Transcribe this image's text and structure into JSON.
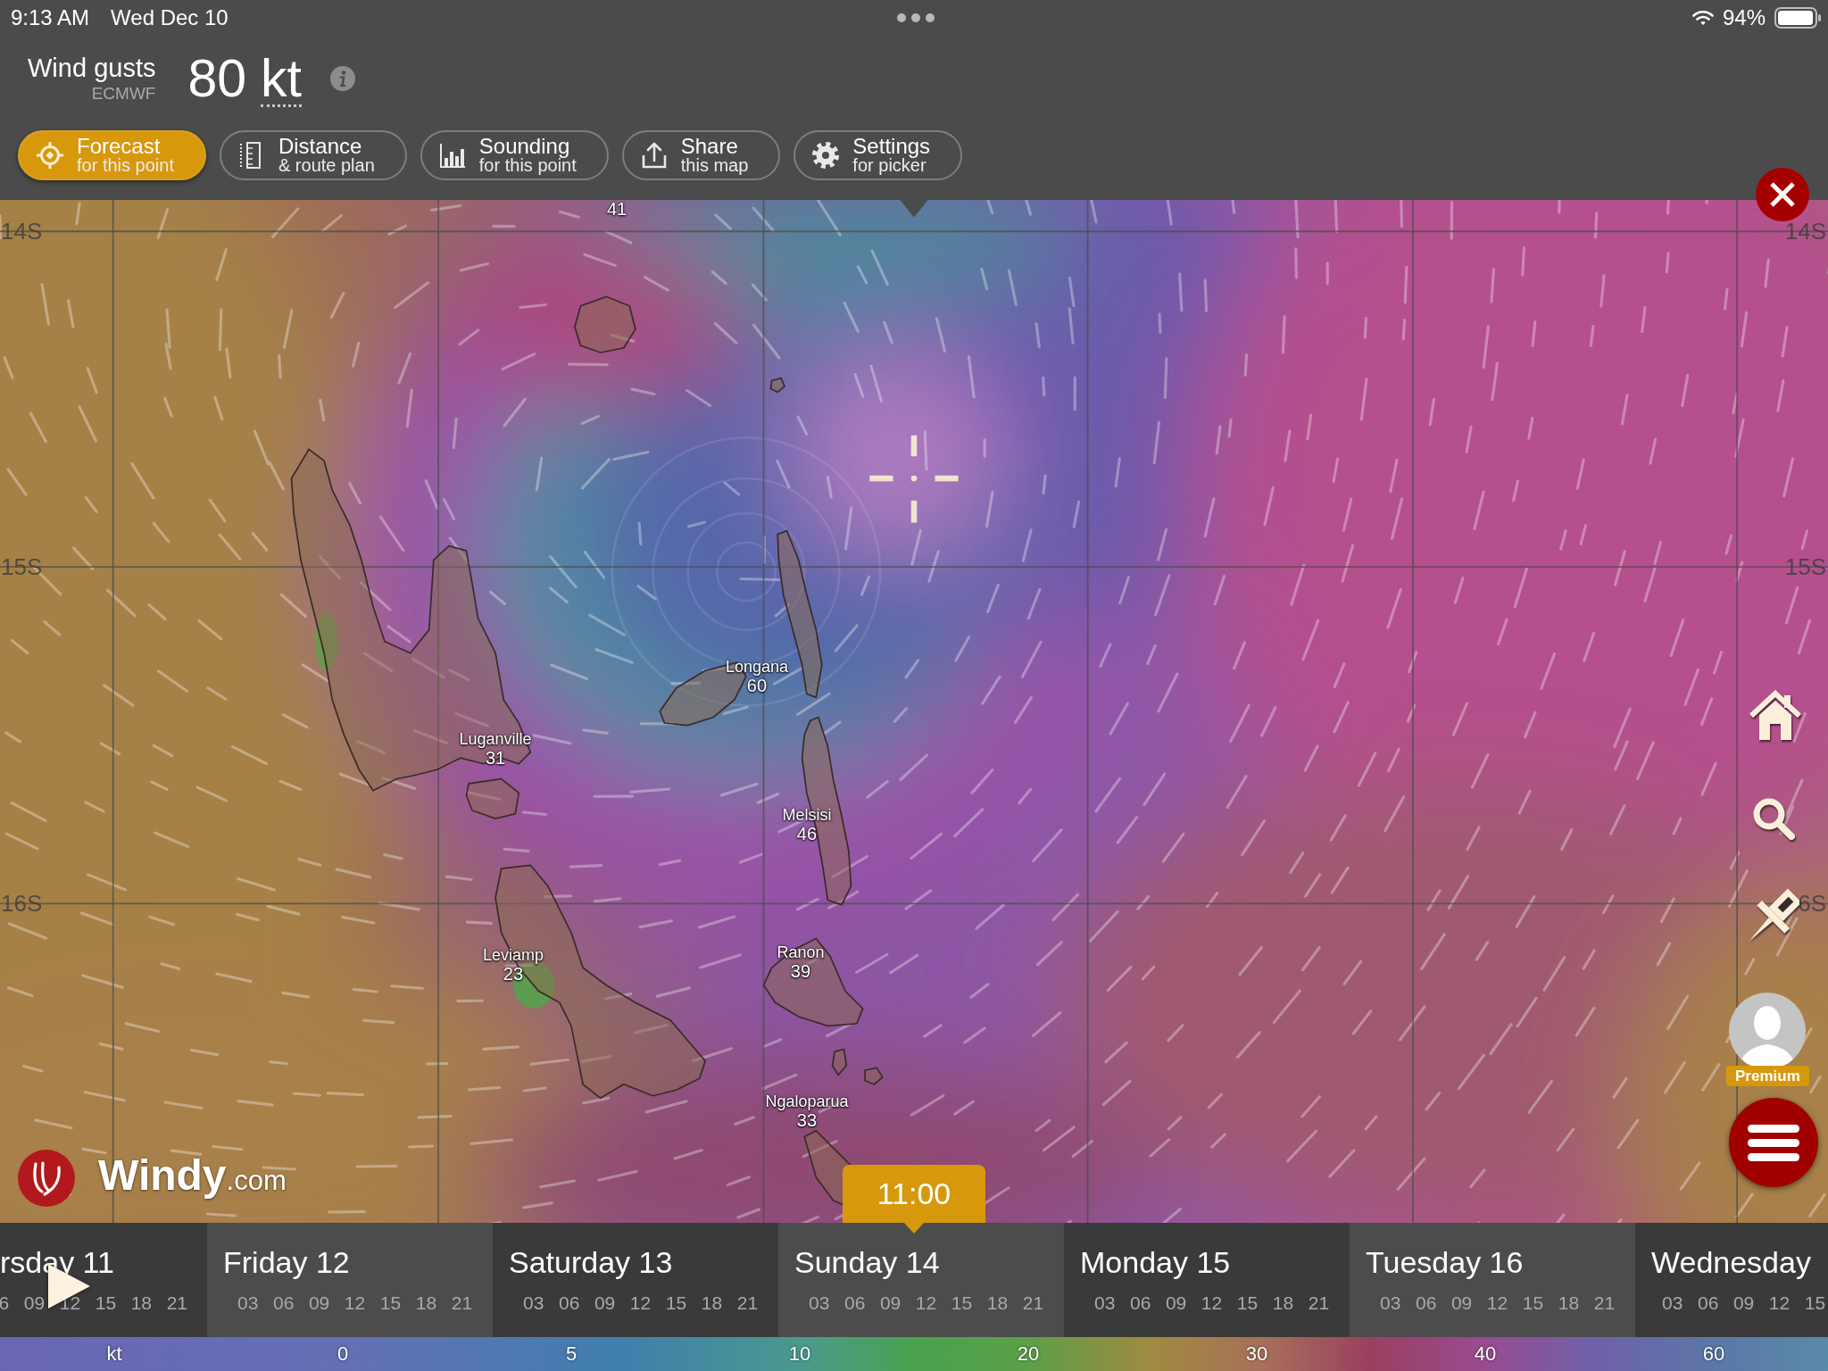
{
  "status_bar": {
    "time": "9:13 AM",
    "date": "Wed Dec 10",
    "battery": "94%"
  },
  "layer": {
    "name": "Wind gusts",
    "model": "ECMWF",
    "value": "80",
    "unit": "kt"
  },
  "actions": [
    {
      "kind": "forecast",
      "title": "Forecast",
      "subtitle": "for this point",
      "selected": true
    },
    {
      "kind": "distance",
      "title": "Distance",
      "subtitle": "& route plan",
      "selected": false
    },
    {
      "kind": "sounding",
      "title": "Sounding",
      "subtitle": "for this point",
      "selected": false
    },
    {
      "kind": "share",
      "title": "Share",
      "subtitle": "this map",
      "selected": false
    },
    {
      "kind": "settings",
      "title": "Settings",
      "subtitle": "for picker",
      "selected": false
    }
  ],
  "map": {
    "latitudes_left": [
      "14S",
      "15S",
      "16S"
    ],
    "latitudes_right": [
      "14S",
      "15S",
      "6S"
    ],
    "places": [
      {
        "value": "41"
      },
      {
        "name": "Longana",
        "value": "60"
      },
      {
        "name": "Luganville",
        "value": "31"
      },
      {
        "name": "Melsisi",
        "value": "46"
      },
      {
        "name": "Leviamp",
        "value": "23"
      },
      {
        "name": "Ranon",
        "value": "39"
      },
      {
        "name": "Ngaloparua",
        "value": "33"
      }
    ]
  },
  "account": {
    "badge": "Premium"
  },
  "brand": {
    "name": "Windy",
    "suffix": ".com"
  },
  "timeline": {
    "time": "11:00",
    "days": [
      {
        "label": "rsday 11",
        "hours": [
          "6",
          "09",
          "12",
          "15",
          "18",
          "21"
        ]
      },
      {
        "label": "Friday 12",
        "hours": [
          "03",
          "06",
          "09",
          "12",
          "15",
          "18",
          "21"
        ]
      },
      {
        "label": "Saturday 13",
        "hours": [
          "03",
          "06",
          "09",
          "12",
          "15",
          "18",
          "21"
        ]
      },
      {
        "label": "Sunday 14",
        "hours": [
          "03",
          "06",
          "09",
          "12",
          "15",
          "18",
          "21"
        ]
      },
      {
        "label": "Monday 15",
        "hours": [
          "03",
          "06",
          "09",
          "12",
          "15",
          "18",
          "21"
        ]
      },
      {
        "label": "Tuesday 16",
        "hours": [
          "03",
          "06",
          "09",
          "12",
          "15",
          "18",
          "21"
        ]
      },
      {
        "label": "Wednesday",
        "hours": [
          "03",
          "06",
          "09",
          "12",
          "15"
        ]
      }
    ]
  },
  "legend": {
    "unit": "kt",
    "ticks": [
      "0",
      "5",
      "10",
      "20",
      "30",
      "40",
      "60"
    ]
  }
}
